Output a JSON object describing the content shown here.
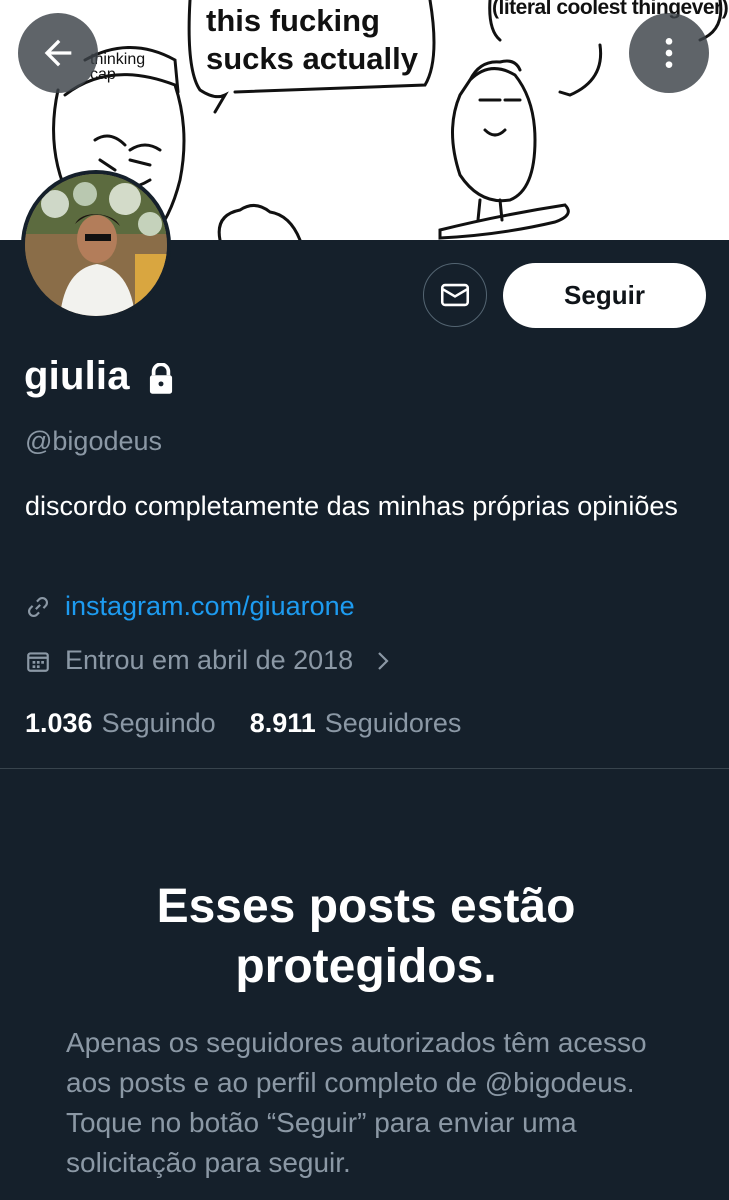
{
  "banner": {
    "speech_main": "this fucking sucks actually",
    "speech_cool": "(literal coolest thingever)",
    "cap_label": "thinking cap"
  },
  "header": {
    "back_icon": "arrow-left-icon",
    "more_icon": "more-vertical-icon"
  },
  "profile": {
    "display_name": "giulia",
    "handle": "@bigodeus",
    "bio": "discordo completamente das minhas próprias opiniões",
    "link_text": "instagram.com/giuarone",
    "joined_text": "Entrou em abril de 2018",
    "locked_icon": "lock-icon"
  },
  "actions": {
    "message_icon": "envelope-icon",
    "follow_label": "Seguir"
  },
  "stats": {
    "following_count": "1.036",
    "following_label": "Seguindo",
    "followers_count": "8.911",
    "followers_label": "Seguidores"
  },
  "protected": {
    "title": "Esses posts estão protegidos.",
    "description": "Apenas os seguidores autorizados têm acesso aos posts e ao perfil completo de @bigodeus. Toque no botão “Seguir” para enviar uma solicitação para seguir."
  },
  "colors": {
    "background": "#15202b",
    "link": "#1d9bf0",
    "secondary_text": "#8b98a5"
  }
}
